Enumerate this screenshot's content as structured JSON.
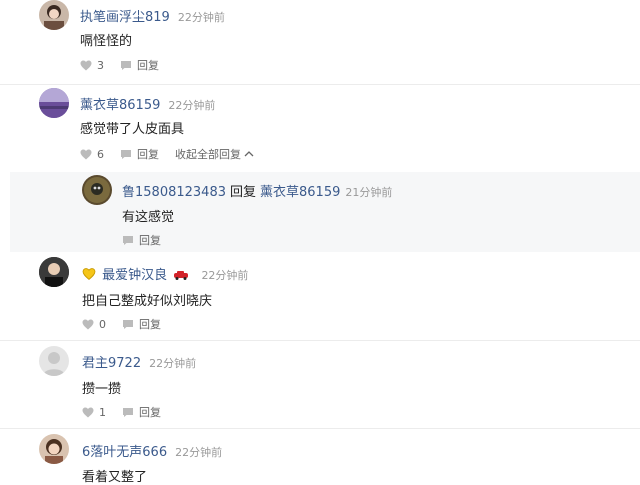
{
  "comments": [
    {
      "user": "执笔画浮尘819",
      "time": "22分钟前",
      "text": "嗝怪怪的",
      "likes": "3",
      "reply": "回复"
    },
    {
      "user": "薰衣草86159",
      "time": "22分钟前",
      "text": "感觉带了人皮面具",
      "likes": "6",
      "reply": "回复",
      "collapse": "收起全部回复"
    },
    {
      "user": "鲁15808123483",
      "reply_word": "回复",
      "reply_to": "薰衣草86159",
      "time": "21分钟前",
      "text": "有这感觉",
      "reply": "回复"
    },
    {
      "user": "最爱钟汉良",
      "time": "22分钟前",
      "text": "把自己整成好似刘晓庆",
      "likes": "0",
      "reply": "回复"
    },
    {
      "user": "君主9722",
      "time": "22分钟前",
      "text": "攒一攒",
      "likes": "1",
      "reply": "回复"
    },
    {
      "user": "6落叶无声666",
      "time": "22分钟前",
      "text": "看着又整了"
    }
  ],
  "icons": {
    "like": "heart-icon",
    "reply": "comment-icon",
    "collapse": "chevron-up-icon",
    "badge": "heart-badge-icon",
    "car": "car-icon"
  },
  "colors": {
    "username": "#3b5a8c",
    "time": "#999999",
    "reply_bg": "#f6f7f8"
  }
}
